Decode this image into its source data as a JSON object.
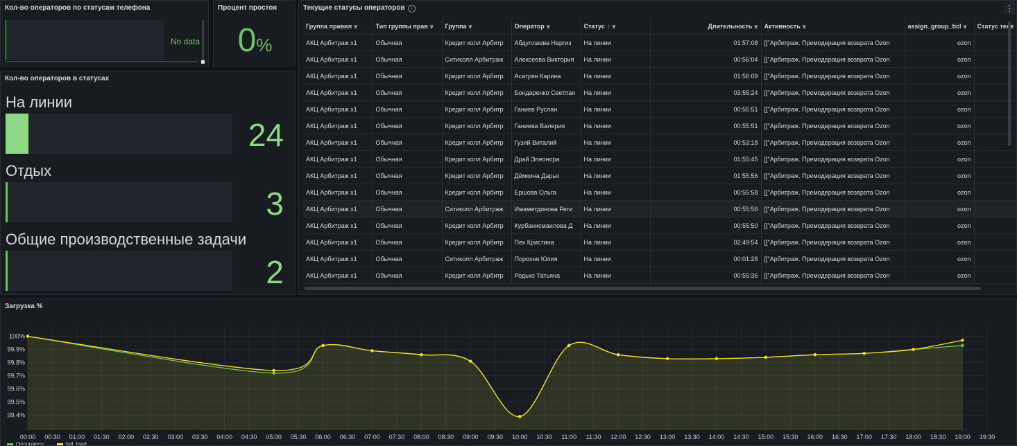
{
  "panel_phone": {
    "title": "Кол-во операторов по статусам телефона",
    "nodata": "No data"
  },
  "panel_idle": {
    "title": "Процент простоя",
    "value": "0",
    "unit": "%"
  },
  "panel_status_counts": {
    "title": "Кол-во операторов в статусах",
    "bars": [
      {
        "label": "На линии",
        "value": "24",
        "fill_percent": 10
      },
      {
        "label": "Отдых",
        "value": "3",
        "fill_percent": 1
      },
      {
        "label": "Общие производственные задачи",
        "value": "2",
        "fill_percent": 1
      }
    ]
  },
  "panel_table": {
    "title": "Текущие статусы операторов",
    "info_icon": "info-icon",
    "menu_icon": "⋮",
    "sort_indicator": "↑",
    "columns": [
      "Группа правил",
      "Тип группы прав",
      "Группа",
      "Оператор",
      "Статус",
      "Длительность",
      "Активность",
      "assign_group_ticl",
      "Статус теле"
    ],
    "rows": [
      [
        "АКЦ Арбитраж x1",
        "Обычная",
        "Кредит колл Арбитр",
        "Абдуллаева Наргиз",
        "На линии",
        "01:57:08",
        "[[\"Арбитраж. Премодерация возврата Ozon",
        "ozon",
        ""
      ],
      [
        "АКЦ Арбитраж x1",
        "Обычная",
        "Ситиколл Арбитраж",
        "Алексеева Виктория",
        "На линии",
        "00:56:04",
        "[[\"Арбитраж. Премодерация возврата Ozon",
        "ozon",
        ""
      ],
      [
        "АКЦ Арбитраж x1",
        "Обычная",
        "Кредит колл Арбитр",
        "Асатрян Карина",
        "На линии",
        "01:56:09",
        "[[\"Арбитраж. Премодерация возврата Ozon",
        "ozon",
        ""
      ],
      [
        "АКЦ Арбитраж x1",
        "Обычная",
        "Кредит колл Арбитр",
        "Бондаренко Светлан",
        "На линии",
        "03:55:24",
        "[[\"Арбитраж. Премодерация возврата Ozon",
        "ozon",
        ""
      ],
      [
        "АКЦ Арбитраж x1",
        "Обычная",
        "Кредит колл Арбитр",
        "Ганиев Руслан",
        "На линии",
        "00:55:51",
        "[[\"Арбитраж. Премодерация возврата Ozon",
        "ozon",
        ""
      ],
      [
        "АКЦ Арбитраж x1",
        "Обычная",
        "Кредит колл Арбитр",
        "Ганиева Валерия",
        "На линии",
        "00:55:51",
        "[[\"Арбитраж. Премодерация возврата Ozon",
        "ozon",
        ""
      ],
      [
        "АКЦ Арбитраж x1",
        "Обычная",
        "Кредит колл Арбитр",
        "Гузий Виталий",
        "На линии",
        "00:53:18",
        "[[\"Арбитраж. Премодерация возврата Ozon",
        "ozon",
        ""
      ],
      [
        "АКЦ Арбитраж x1",
        "Обычная",
        "Кредит колл Арбитр",
        "Драй Элеонора",
        "На линии",
        "01:55:45",
        "[[\"Арбитраж. Премодерация возврата Ozon",
        "ozon",
        ""
      ],
      [
        "АКЦ Арбитраж x1",
        "Обычная",
        "Кредит колл Арбитр",
        "Дёмкина Дарья",
        "На линии",
        "01:55:56",
        "[[\"Арбитраж. Премодерация возврата Ozon",
        "ozon",
        ""
      ],
      [
        "АКЦ Арбитраж x1",
        "Обычная",
        "Кредит колл Арбитр",
        "Ершова Ольга",
        "На линии",
        "00:55:58",
        "[[\"Арбитраж. Премодерация возврата Ozon",
        "ozon",
        ""
      ],
      [
        "АКЦ Арбитраж x1",
        "Обычная",
        "Ситиколл Арбитраж",
        "Имаметдинова Реги",
        "На линии",
        "00:55:56",
        "[[\"Арбитраж. Премодерация возврата Ozon",
        "ozon",
        ""
      ],
      [
        "АКЦ Арбитраж x1",
        "Обычная",
        "Кредит колл Арбитр",
        "Курбанисмаилова Д",
        "На линии",
        "00:55:50",
        "[[\"Арбитраж. Премодерация возврата Ozon",
        "ozon",
        ""
      ],
      [
        "АКЦ Арбитраж x1",
        "Обычная",
        "Кредит колл Арбитр",
        "Пех Кристина",
        "На линии",
        "02:49:54",
        "[[\"Арбитраж. Премодерация возврата Ozon",
        "ozon",
        ""
      ],
      [
        "АКЦ Арбитраж x1",
        "Обычная",
        "Ситиколл Арбитраж",
        "Порохня Юлия",
        "На линии",
        "00:01:28",
        "[[\"Арбитраж. Премодерация возврата Ozon",
        "ozon",
        ""
      ],
      [
        "АКЦ Арбитраж x1",
        "Обычная",
        "Кредит колл Арбитр",
        "Родько Татьяна",
        "На линии",
        "00:55:36",
        "[[\"Арбитраж. Премодерация возврата Ozon",
        "ozon",
        ""
      ]
    ]
  },
  "panel_load": {
    "title": "Загрузка %"
  },
  "colors": {
    "green": "#73bf69",
    "yellow": "#fade2a",
    "panel_bg": "#181b1f",
    "page_bg": "#111217"
  },
  "chart_data": {
    "type": "line",
    "title": "Загрузка %",
    "x": [
      "00:00",
      "00:30",
      "01:00",
      "01:30",
      "02:00",
      "02:30",
      "03:00",
      "03:30",
      "04:00",
      "04:30",
      "05:00",
      "05:30",
      "06:00",
      "06:30",
      "07:00",
      "07:30",
      "08:00",
      "08:30",
      "09:00",
      "09:30",
      "10:00",
      "10:30",
      "11:00",
      "11:30",
      "12:00",
      "12:30",
      "13:00",
      "13:30",
      "14:00",
      "14:30",
      "15:00",
      "15:30",
      "16:00",
      "16:30",
      "17:00",
      "17:30",
      "18:00",
      "18:30",
      "19:00",
      "19:30"
    ],
    "y_ticks": [
      "100%",
      "99.9%",
      "99.8%",
      "99.7%",
      "99.6%",
      "99.5%",
      "99.4%"
    ],
    "ylim": [
      99.35,
      100.04
    ],
    "series": [
      {
        "name": "Occupancy",
        "color": "#73bf69",
        "points": [
          [
            "00:00",
            100.0
          ],
          [
            "05:00",
            99.72
          ],
          [
            "06:00",
            99.93
          ],
          [
            "07:00",
            99.89
          ],
          [
            "08:00",
            99.86
          ],
          [
            "09:00",
            99.81
          ],
          [
            "10:00",
            99.39
          ],
          [
            "11:00",
            99.93
          ],
          [
            "12:00",
            99.86
          ],
          [
            "13:00",
            99.83
          ],
          [
            "14:00",
            99.83
          ],
          [
            "15:00",
            99.84
          ],
          [
            "16:00",
            99.86
          ],
          [
            "17:00",
            99.87
          ],
          [
            "18:00",
            99.9
          ],
          [
            "19:00",
            99.93
          ]
        ]
      },
      {
        "name": "full_load",
        "color": "#fade2a",
        "points": [
          [
            "00:00",
            100.0
          ],
          [
            "05:00",
            99.74
          ],
          [
            "06:00",
            99.93
          ],
          [
            "07:00",
            99.89
          ],
          [
            "08:00",
            99.86
          ],
          [
            "09:00",
            99.81
          ],
          [
            "10:00",
            99.39
          ],
          [
            "11:00",
            99.93
          ],
          [
            "12:00",
            99.86
          ],
          [
            "13:00",
            99.83
          ],
          [
            "14:00",
            99.83
          ],
          [
            "15:00",
            99.84
          ],
          [
            "16:00",
            99.86
          ],
          [
            "17:00",
            99.87
          ],
          [
            "18:00",
            99.9
          ],
          [
            "19:00",
            99.97
          ]
        ]
      }
    ],
    "legend": "bottom-left",
    "grid": true
  }
}
